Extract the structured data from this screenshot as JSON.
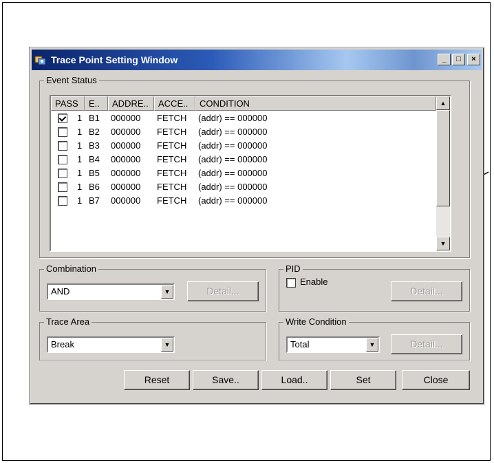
{
  "window": {
    "title": "Trace Point Setting Window",
    "minimize_glyph": "_",
    "maximize_glyph": "□",
    "close_glyph": "×"
  },
  "event_status": {
    "group_label": "Event Status",
    "columns": [
      "PASS",
      "E..",
      "ADDRE..",
      "ACCE..",
      "CONDITION"
    ],
    "rows": [
      {
        "checked": true,
        "pass": "1",
        "event": "B1",
        "address": "000000",
        "access": "FETCH",
        "condition": "(addr) == 000000"
      },
      {
        "checked": false,
        "pass": "1",
        "event": "B2",
        "address": "000000",
        "access": "FETCH",
        "condition": "(addr) == 000000"
      },
      {
        "checked": false,
        "pass": "1",
        "event": "B3",
        "address": "000000",
        "access": "FETCH",
        "condition": "(addr) == 000000"
      },
      {
        "checked": false,
        "pass": "1",
        "event": "B4",
        "address": "000000",
        "access": "FETCH",
        "condition": "(addr) == 000000"
      },
      {
        "checked": false,
        "pass": "1",
        "event": "B5",
        "address": "000000",
        "access": "FETCH",
        "condition": "(addr) == 000000"
      },
      {
        "checked": false,
        "pass": "1",
        "event": "B6",
        "address": "000000",
        "access": "FETCH",
        "condition": "(addr) == 000000"
      },
      {
        "checked": false,
        "pass": "1",
        "event": "B7",
        "address": "000000",
        "access": "FETCH",
        "condition": "(addr) == 000000"
      }
    ]
  },
  "combination": {
    "group_label": "Combination",
    "selected": "AND",
    "detail_label": "Detail..."
  },
  "pid": {
    "group_label": "PID",
    "enable_label": "Enable",
    "enabled": false,
    "detail_label": "Detail..."
  },
  "trace_area": {
    "group_label": "Trace Area",
    "selected": "Break"
  },
  "write_condition": {
    "group_label": "Write Condition",
    "selected": "Total",
    "detail_label": "Detail..."
  },
  "buttons": {
    "reset": "Reset",
    "save": "Save..",
    "load": "Load..",
    "set": "Set",
    "close": "Close"
  },
  "colors": {
    "title_gradient_start": "#0a246a",
    "dialog_face": "#d6d3ce",
    "disabled_text": "#9e9e9e"
  }
}
